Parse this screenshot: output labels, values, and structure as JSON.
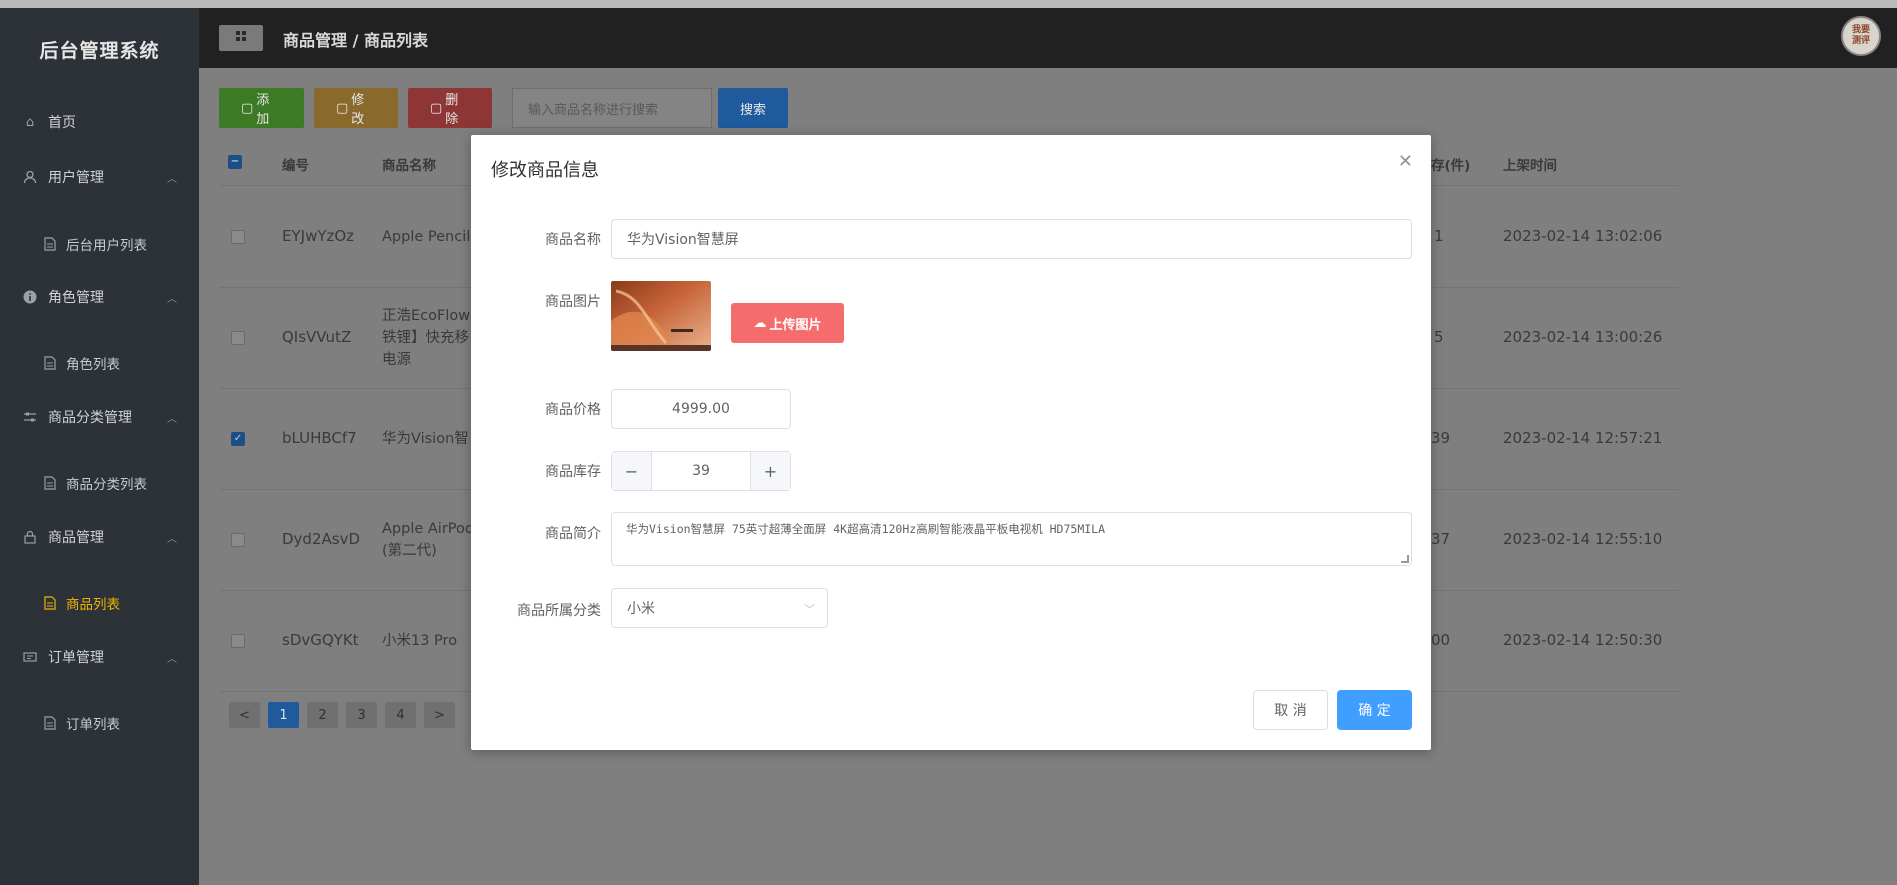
{
  "app": {
    "title": "后台管理系统"
  },
  "header": {
    "breadcrumb": "商品管理 / 商品列表",
    "avatar_text_line1": "我要",
    "avatar_text_line2": "测评"
  },
  "sidebar": {
    "items": [
      {
        "label": "首页",
        "icon": "home-icon"
      },
      {
        "label": "用户管理",
        "icon": "user-icon"
      },
      {
        "label": "后台用户列表",
        "icon": "document-icon"
      },
      {
        "label": "角色管理",
        "icon": "info-icon"
      },
      {
        "label": "角色列表",
        "icon": "document-icon"
      },
      {
        "label": "商品分类管理",
        "icon": "sliders-icon"
      },
      {
        "label": "商品分类列表",
        "icon": "document-icon"
      },
      {
        "label": "商品管理",
        "icon": "lock-icon"
      },
      {
        "label": "商品列表",
        "icon": "document-icon"
      },
      {
        "label": "订单管理",
        "icon": "tickets-icon"
      },
      {
        "label": "订单列表",
        "icon": "document-icon"
      }
    ]
  },
  "toolbar": {
    "add": "添加",
    "edit": "修改",
    "delete": "删除",
    "search_placeholder": "输入商品名称进行搜索",
    "search_button": "搜索"
  },
  "table": {
    "headers": {
      "id": "编号",
      "name": "商品名称",
      "stock": "存(件)",
      "time": "上架时间"
    },
    "rows": [
      {
        "id": "EYJwYzOz",
        "name_line1": "Apple Pencil",
        "name_line2": "",
        "name_line3": "",
        "stock": "1",
        "time": "2023-02-14 13:02:06",
        "checked": false
      },
      {
        "id": "QIsVVutZ",
        "name_line1": "正浩EcoFlow",
        "name_line2": "铁锂】快充移",
        "name_line3": "电源",
        "stock": "5",
        "time": "2023-02-14 13:00:26",
        "checked": false
      },
      {
        "id": "bLUHBCf7",
        "name_line1": "华为Vision智",
        "name_line2": "",
        "name_line3": "",
        "stock": "39",
        "time": "2023-02-14 12:57:21",
        "checked": true
      },
      {
        "id": "Dyd2AsvD",
        "name_line1": "Apple AirPod",
        "name_line2": "(第二代)",
        "name_line3": "",
        "stock": "37",
        "time": "2023-02-14 12:55:10",
        "checked": false
      },
      {
        "id": "sDvGQYKt",
        "name_line1": "小米13 Pro",
        "name_line2": "",
        "name_line3": "",
        "stock": "00",
        "time": "2023-02-14 12:50:30",
        "checked": false
      }
    ]
  },
  "pagination": {
    "pages": [
      "1",
      "2",
      "3",
      "4"
    ],
    "current": "1",
    "prev": "<",
    "next": ">"
  },
  "modal": {
    "title": "修改商品信息",
    "labels": {
      "name": "商品名称",
      "image": "商品图片",
      "price": "商品价格",
      "stock": "商品库存",
      "intro": "商品简介",
      "category": "商品所属分类"
    },
    "values": {
      "name": "华为Vision智慧屏",
      "price": "4999.00",
      "stock": "39",
      "intro": "华为Vision智慧屏 75英寸超薄全面屏 4K超高清120Hz高刷智能液晶平板电视机 HD75MILA",
      "category": "小米"
    },
    "upload_button": "上传图片",
    "stepper_minus": "−",
    "stepper_plus": "+",
    "cancel": "取 消",
    "confirm": "确 定"
  },
  "colors": {
    "sidebar_bg": "#2d3238",
    "header_bg": "#212121",
    "primary": "#409eff",
    "danger": "#f56c6c",
    "active_menu": "#f0b400"
  }
}
